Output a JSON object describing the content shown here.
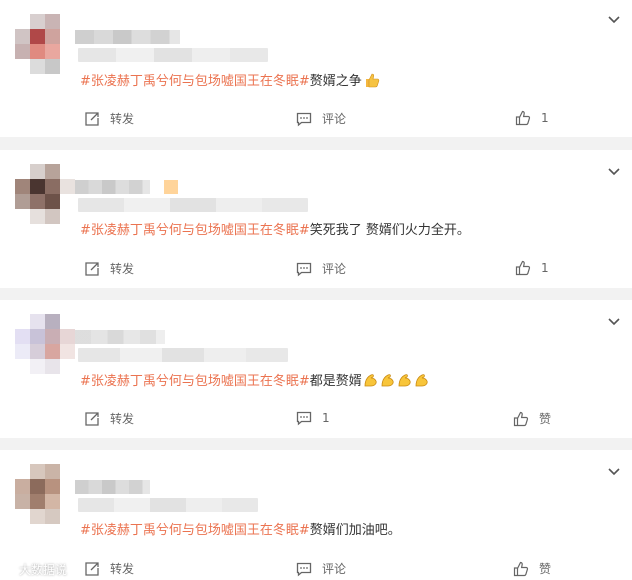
{
  "labels": {
    "repost": "转发",
    "comment": "评论",
    "like": "赞"
  },
  "comments": [
    {
      "hashtag": "#张凌赫丁禹兮何与包场嘘国王在冬眠#",
      "text": "赘婿之争",
      "emoji": "thumbs-up",
      "comment_count": "",
      "like_count": "1",
      "avatar_colors": [
        "#ffffff",
        "#d8cfcf",
        "#c9b4b4",
        "#ffffff",
        "#d0c4c4",
        "#b04848",
        "#cfa39e",
        "#ffffff",
        "#c7b1b1",
        "#e08a80",
        "#e9a79f",
        "#ffffff",
        "#ffffff",
        "#dcdcdc",
        "#c8c8c8",
        "#ffffff"
      ]
    },
    {
      "hashtag": "#张凌赫丁禹兮何与包场嘘国王在冬眠#",
      "text": "笑死我了 赘婿们火力全开。",
      "emoji": "",
      "comment_count": "",
      "like_count": "1",
      "avatar_colors": [
        "#ffffff",
        "#d7cfcc",
        "#b7a39a",
        "#ffffff",
        "#a0857a",
        "#4a3530",
        "#8a6d63",
        "#e9e2df",
        "#b09d95",
        "#8e7168",
        "#6d5249",
        "#ffffff",
        "#ffffff",
        "#e6e0dd",
        "#d2c6c1",
        "#ffffff"
      ]
    },
    {
      "hashtag": "#张凌赫丁禹兮何与包场嘘国王在冬眠#",
      "text": "都是赘婿",
      "emoji": "flexed-biceps-x4",
      "comment_count": "1",
      "like_count": "赞",
      "avatar_colors": [
        "#ffffff",
        "#e6e2ee",
        "#b8b0bf",
        "#ffffff",
        "#e3dff3",
        "#c8c2d8",
        "#c9aeb4",
        "#e7d6d6",
        "#ecebf7",
        "#d6cdd9",
        "#d8a6a0",
        "#f1e4e2",
        "#ffffff",
        "#f2f0f5",
        "#e8e4ea",
        "#ffffff"
      ]
    },
    {
      "hashtag": "#张凌赫丁禹兮何与包场嘘国王在冬眠#",
      "text": "赘婿们加油吧。",
      "emoji": "",
      "comment_count": "",
      "like_count": "赞",
      "avatar_colors": [
        "#ffffff",
        "#d7c7bd",
        "#cab4a7",
        "#ffffff",
        "#c9aea0",
        "#8c6b5c",
        "#b8927f",
        "#ffffff",
        "#c8b2a6",
        "#a07e6d",
        "#d3b6a5",
        "#ffffff",
        "#ffffff",
        "#e1d6cf",
        "#d6c9c1",
        "#ffffff"
      ]
    }
  ],
  "watermark": "大数据说"
}
